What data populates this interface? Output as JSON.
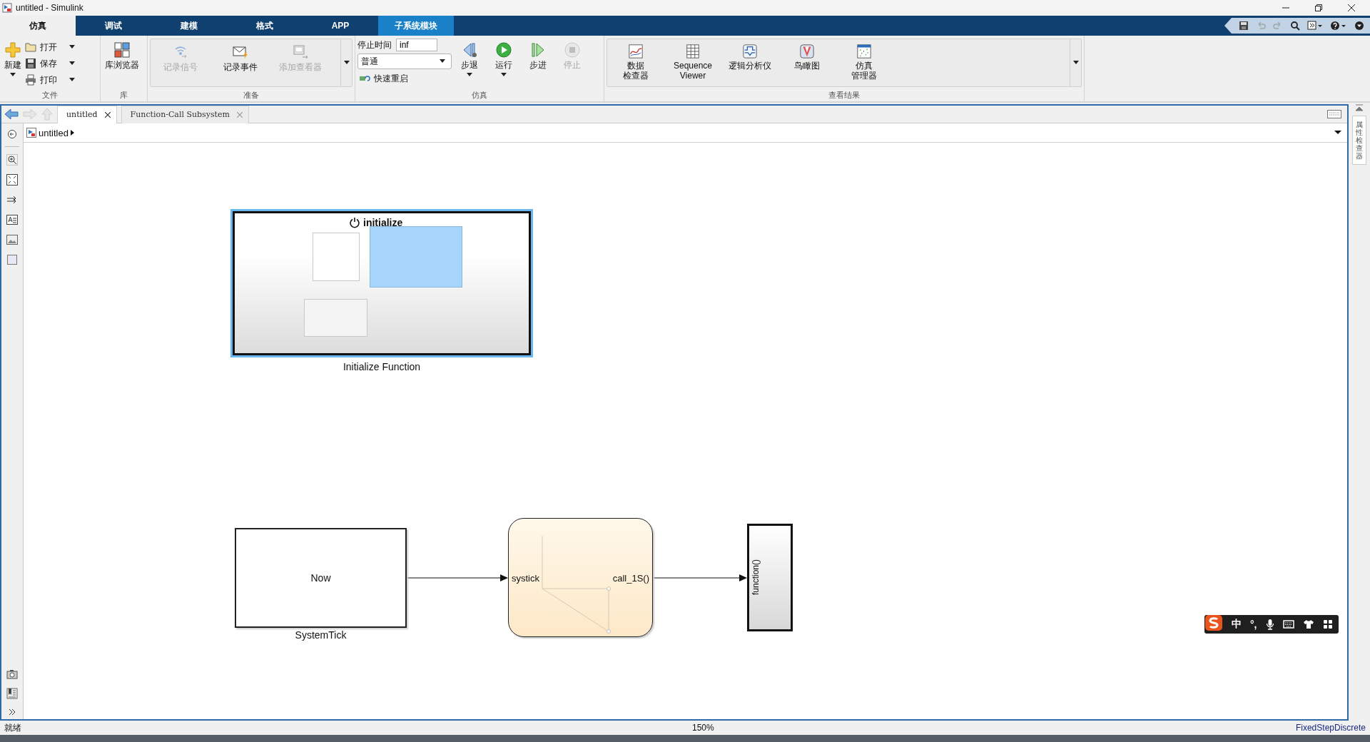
{
  "window": {
    "title": "untitled - Simulink"
  },
  "ribbon_tabs": [
    {
      "label": "仿真",
      "selected": true,
      "kind": "normal"
    },
    {
      "label": "调试",
      "selected": false,
      "kind": "normal"
    },
    {
      "label": "建模",
      "selected": false,
      "kind": "normal"
    },
    {
      "label": "格式",
      "selected": false,
      "kind": "normal"
    },
    {
      "label": "APP",
      "selected": false,
      "kind": "normal"
    },
    {
      "label": "子系统模块",
      "selected": false,
      "kind": "contextual"
    }
  ],
  "ribbon": {
    "file": {
      "title": "文件",
      "new": "新建",
      "open": "打开",
      "save": "保存",
      "print": "打印"
    },
    "library": {
      "title": "库",
      "browser": "库浏览器"
    },
    "prepare": {
      "title": "准备",
      "buttons": [
        {
          "label": "记录信号",
          "disabled": true
        },
        {
          "label": "记录事件",
          "disabled": false
        },
        {
          "label": "添加查看器",
          "disabled": true
        }
      ]
    },
    "simulate": {
      "title": "仿真",
      "stop_time_label": "停止时间",
      "stop_time": "inf",
      "mode": "普通",
      "fast_restart": "快速重启",
      "buttons": [
        {
          "label": "步退",
          "disabled": false,
          "dropdown": true
        },
        {
          "label": "运行",
          "disabled": false,
          "dropdown": true
        },
        {
          "label": "步进",
          "disabled": false,
          "dropdown": false
        },
        {
          "label": "停止",
          "disabled": true,
          "dropdown": false
        }
      ]
    },
    "review": {
      "title": "查看结果",
      "buttons": [
        {
          "lines": [
            "数据",
            "检查器"
          ]
        },
        {
          "lines": [
            "Sequence",
            "Viewer"
          ]
        },
        {
          "lines": [
            "逻辑分析仪"
          ]
        },
        {
          "lines": [
            "鸟瞰图"
          ]
        },
        {
          "lines": [
            "仿真",
            "管理器"
          ]
        }
      ]
    }
  },
  "editor_tabs": [
    {
      "label": "untitled",
      "selected": true
    },
    {
      "label": "Function-Call Subsystem",
      "selected": false
    }
  ],
  "breadcrumb": "untitled",
  "diagram": {
    "blocks": [
      {
        "kind": "initialize",
        "header": "initialize",
        "name": "Initialize Function",
        "selected": true
      },
      {
        "kind": "subsystem",
        "text": "Now",
        "name": "SystemTick",
        "selected": false
      },
      {
        "kind": "chart",
        "input": "systick",
        "output": "call_1S()",
        "selected": false
      },
      {
        "kind": "function_call",
        "port": "function()",
        "selected": false
      }
    ]
  },
  "side_panel": {
    "label": "属性检查器"
  },
  "ime_bar": {
    "mode": "中",
    "punctuation": "°,"
  },
  "status_bar": {
    "status": "就绪",
    "zoom": "150%",
    "solver": "FixedStepDiscrete"
  }
}
